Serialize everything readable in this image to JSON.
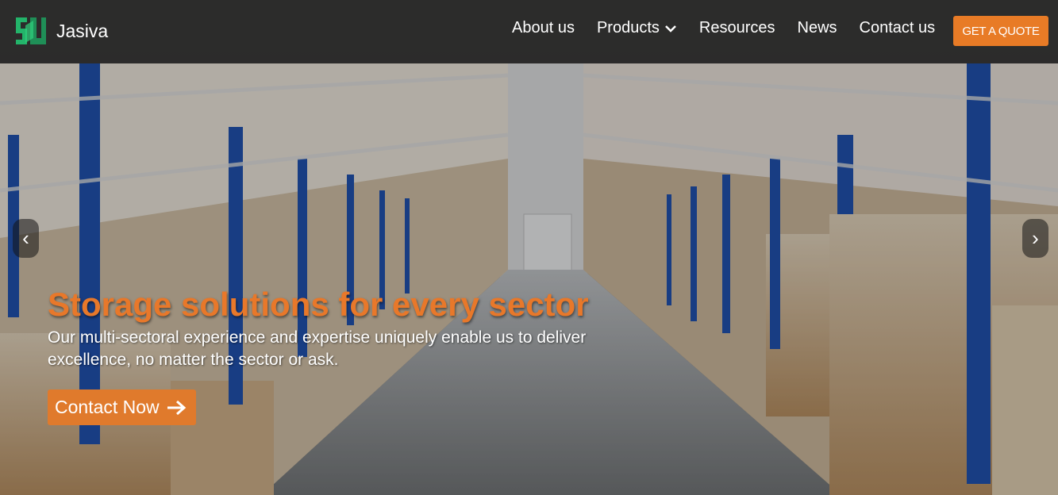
{
  "brand": {
    "name": "Jasiva",
    "logo_icon": "jasiva-logo-icon"
  },
  "nav": {
    "items": [
      {
        "label": "About us"
      },
      {
        "label": "Products",
        "icon": "chevron-down-icon"
      },
      {
        "label": "Resources"
      },
      {
        "label": "News"
      },
      {
        "label": "Contact us"
      }
    ],
    "quote_label": "GET A QUOTE"
  },
  "carousel": {
    "prev_icon": "chevron-left-icon",
    "next_icon": "chevron-right-icon",
    "prev_glyph": "‹",
    "next_glyph": "›"
  },
  "hero": {
    "headline": "Storage solutions for every sector",
    "subtext": "Our multi-sectoral experience and expertise uniquely enable us to deliver excellence, no matter the sector or ask.",
    "cta_label": "Contact Now",
    "cta_icon": "arrow-right-icon"
  },
  "colors": {
    "accent": "#e87b26",
    "header_bg": "#232323",
    "rack_blue": "#1f4fa8"
  }
}
